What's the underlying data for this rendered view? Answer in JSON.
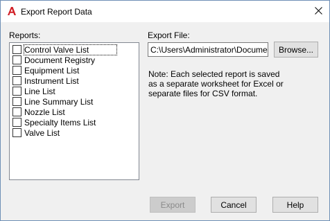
{
  "window": {
    "title": "Export Report Data",
    "icon": "autocad-a-icon",
    "close_glyph": "✕"
  },
  "reports": {
    "label": "Reports:",
    "items": [
      {
        "label": "Control Valve List",
        "checked": false
      },
      {
        "label": "Document Registry",
        "checked": false
      },
      {
        "label": "Equipment List",
        "checked": false
      },
      {
        "label": "Instrument List",
        "checked": false
      },
      {
        "label": "Line List",
        "checked": false
      },
      {
        "label": "Line Summary List",
        "checked": false
      },
      {
        "label": "Nozzle List",
        "checked": false
      },
      {
        "label": "Specialty Items List",
        "checked": false
      },
      {
        "label": "Valve List",
        "checked": false
      }
    ]
  },
  "export_file": {
    "label": "Export File:",
    "value": "C:\\Users\\Administrator\\Documents\\",
    "browse_label": "Browse..."
  },
  "note": "Note: Each selected report is saved as a separate worksheet for Excel or separate files for CSV format.",
  "buttons": {
    "export": "Export",
    "cancel": "Cancel",
    "help": "Help"
  },
  "colors": {
    "dialog_bg": "#f0f0f0",
    "titlebar_bg": "#ffffff",
    "icon_red": "#d11f26",
    "border": "#6e8fb6"
  }
}
